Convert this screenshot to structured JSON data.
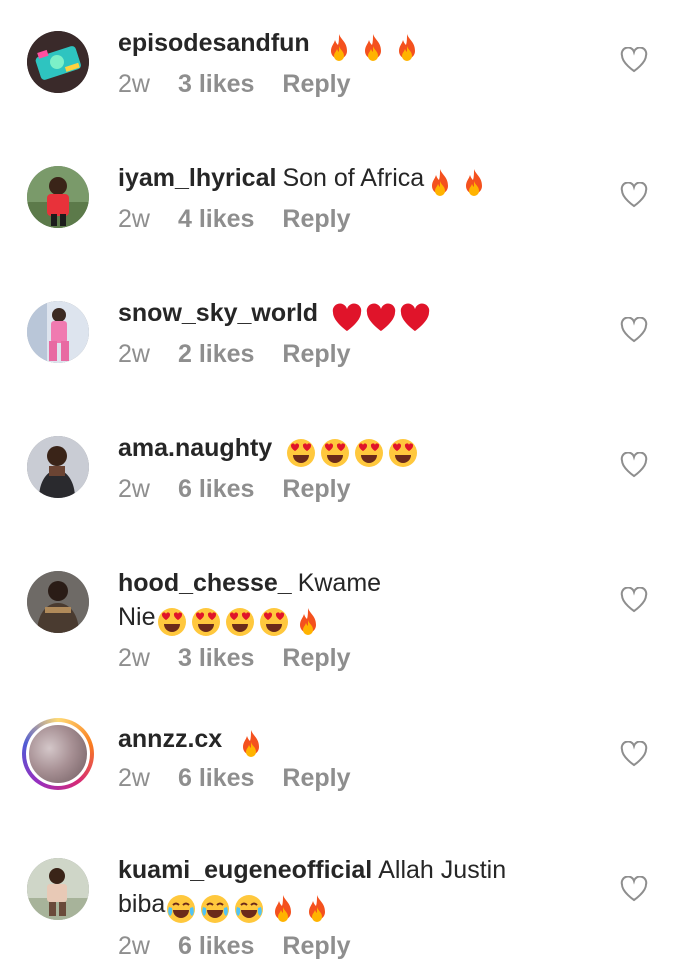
{
  "comments": [
    {
      "username": "episodesandfun",
      "text": "",
      "text2": "",
      "emojis": [
        "fire",
        "fire",
        "fire"
      ],
      "time": "2w",
      "likes": "3 likes",
      "reply": "Reply"
    },
    {
      "username": "iyam_lhyrical",
      "text": "Son of Africa",
      "text2": "",
      "emojis": [
        "fire",
        "fire"
      ],
      "time": "2w",
      "likes": "4 likes",
      "reply": "Reply"
    },
    {
      "username": "snow_sky_world",
      "text": "",
      "text2": "",
      "emojis": [
        "heart",
        "heart",
        "heart"
      ],
      "time": "2w",
      "likes": "2 likes",
      "reply": "Reply"
    },
    {
      "username": "ama.naughty",
      "text": "",
      "text2": "",
      "emojis": [
        "hearteyes",
        "hearteyes",
        "hearteyes",
        "hearteyes"
      ],
      "time": "2w",
      "likes": "6 likes",
      "reply": "Reply"
    },
    {
      "username": "hood_chesse_",
      "text": "Kwame",
      "text2": "Nie",
      "emojis": [
        "hearteyes",
        "hearteyes",
        "hearteyes",
        "hearteyes",
        "fire"
      ],
      "time": "2w",
      "likes": "3 likes",
      "reply": "Reply"
    },
    {
      "username": "annzz.cx",
      "text": "",
      "text2": "",
      "emojis": [
        "fire"
      ],
      "time": "2w",
      "likes": "6 likes",
      "reply": "Reply"
    },
    {
      "username": "kuami_eugeneofficial",
      "text": "Allah Justin",
      "text2": "biba",
      "emojis": [
        "joy",
        "joy",
        "joy",
        "fire",
        "fire"
      ],
      "time": "2w",
      "likes": "6 likes",
      "reply": "Reply"
    }
  ],
  "icons": {
    "like": "heart-outline-icon",
    "fire": "fire-emoji",
    "heart": "red-heart-emoji",
    "hearteyes": "heart-eyes-emoji",
    "joy": "tears-of-joy-emoji"
  },
  "colors": {
    "text": "#262626",
    "meta": "#8e8e8e",
    "story_ring": "#d62976"
  }
}
